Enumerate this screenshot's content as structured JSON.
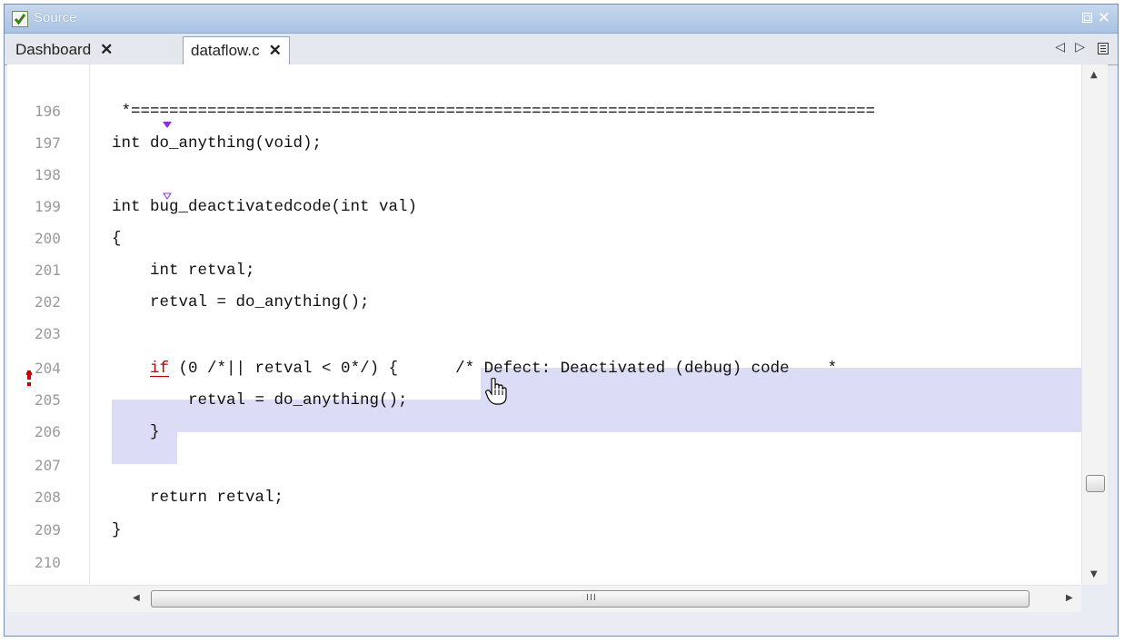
{
  "window": {
    "title": "Source",
    "close_glyph": "✕"
  },
  "tabs": [
    {
      "label": "Dashboard",
      "close": "✕"
    },
    {
      "label": "dataflow.c",
      "close": "✕"
    }
  ],
  "tab_nav": {
    "prev_glyph": "◁",
    "next_glyph": "▷"
  },
  "editor": {
    "lines": [
      {
        "num": "196",
        "code": " *=============================================================================="
      },
      {
        "num": "197",
        "code": "int do_anything(void);"
      },
      {
        "num": "198",
        "code": ""
      },
      {
        "num": "199",
        "code": "int bug_deactivatedcode(int val)"
      },
      {
        "num": "200",
        "code": "{"
      },
      {
        "num": "201",
        "code": "    int retval;"
      },
      {
        "num": "202",
        "code": "    retval = do_anything();"
      },
      {
        "num": "203",
        "code": ""
      },
      {
        "num": "204",
        "code_pre": "    ",
        "keyword": "if",
        "code_post": " (0 /*|| retval < 0*/) {      /* Defect: Deactivated (debug) code    *"
      },
      {
        "num": "205",
        "code": "        retval = do_anything();"
      },
      {
        "num": "206",
        "code": "    }"
      },
      {
        "num": "207",
        "code": ""
      },
      {
        "num": "208",
        "code": "    return retval;"
      },
      {
        "num": "209",
        "code": "}"
      },
      {
        "num": "210",
        "code": ""
      }
    ],
    "defect_line": "204",
    "marker_colors": {
      "filled": "#8a2be2",
      "hollow": "#8a2be2",
      "defect": "#cc0000",
      "highlight": "#dcdcf6"
    }
  },
  "hscroll": {
    "grip": "III"
  },
  "icons": [
    "app-check-icon",
    "restore-icon",
    "close-icon",
    "tab-prev-icon",
    "tab-next-icon",
    "tab-list-icon",
    "defect-marker-icon",
    "hand-cursor-icon"
  ]
}
